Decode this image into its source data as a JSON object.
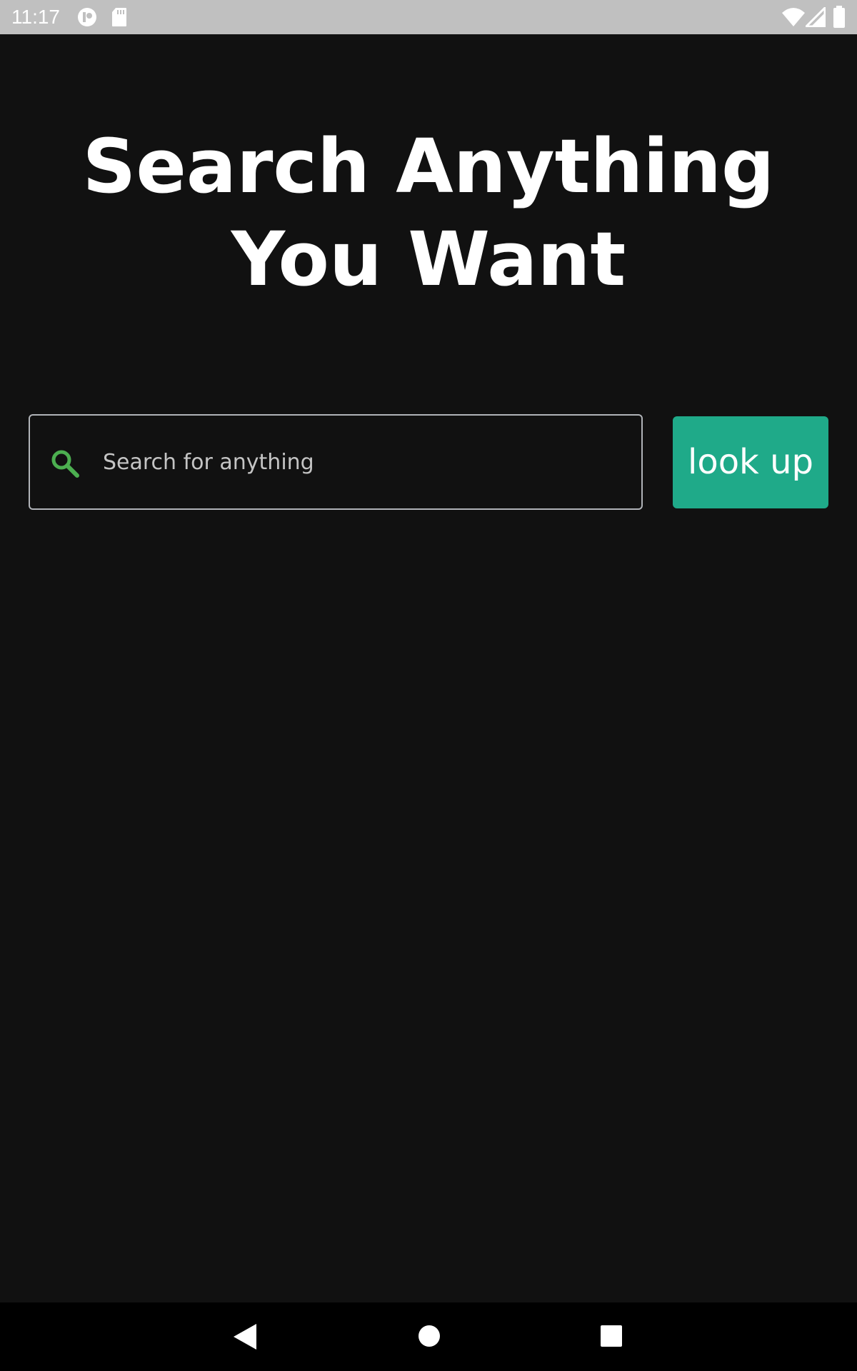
{
  "status_bar": {
    "time": "11:17",
    "icons": [
      "notification-app-icon",
      "sd-card-icon",
      "wifi-icon",
      "cell-signal-icon",
      "battery-icon"
    ]
  },
  "main": {
    "title_line1": "Search Anything",
    "title_line2": "You Want",
    "search": {
      "placeholder": "Search for anything",
      "value": "",
      "icon": "search-icon"
    },
    "lookup_button_label": "look up"
  },
  "nav_bar": {
    "buttons": [
      "back-icon",
      "home-icon",
      "recents-icon"
    ]
  },
  "colors": {
    "background": "#111111",
    "status_bar": "#c0c0c0",
    "accent_button": "#1faa89",
    "search_icon": "#4caf50",
    "field_border": "#b0b3b8",
    "nav_bar": "#000000"
  }
}
